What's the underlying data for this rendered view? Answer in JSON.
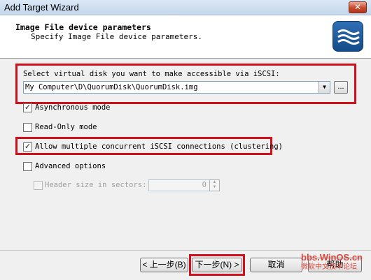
{
  "window": {
    "title": "Add Target Wizard",
    "close_glyph": "✕"
  },
  "header": {
    "title": "Image File device parameters",
    "subtitle": "Specify Image File device parameters."
  },
  "disk": {
    "label": "Select virtual disk you want to make accessible via iSCSI:",
    "path": "My Computer\\D\\QuorumDisk\\QuorumDisk.img",
    "browse_label": "..."
  },
  "options": {
    "async": {
      "label": "Asynchronous mode",
      "checked": true
    },
    "readonly": {
      "label": "Read-Only mode",
      "checked": false
    },
    "multiple": {
      "label": "Allow multiple concurrent iSCSI connections (clustering)",
      "checked": true
    },
    "advanced": {
      "label": "Advanced options",
      "checked": false
    },
    "header_size": {
      "label": "Header size in sectors:",
      "value": "0",
      "checked": false
    }
  },
  "buttons": {
    "back": "< 上一步(B)",
    "next": "下一步(N) >",
    "cancel": "取消",
    "help": "帮助"
  },
  "watermark": {
    "line1": "bbs.WinOS.cn",
    "line2": "微软中文技术论坛"
  },
  "colors": {
    "highlight": "#d0101c",
    "accent": "#2f6fb4"
  }
}
